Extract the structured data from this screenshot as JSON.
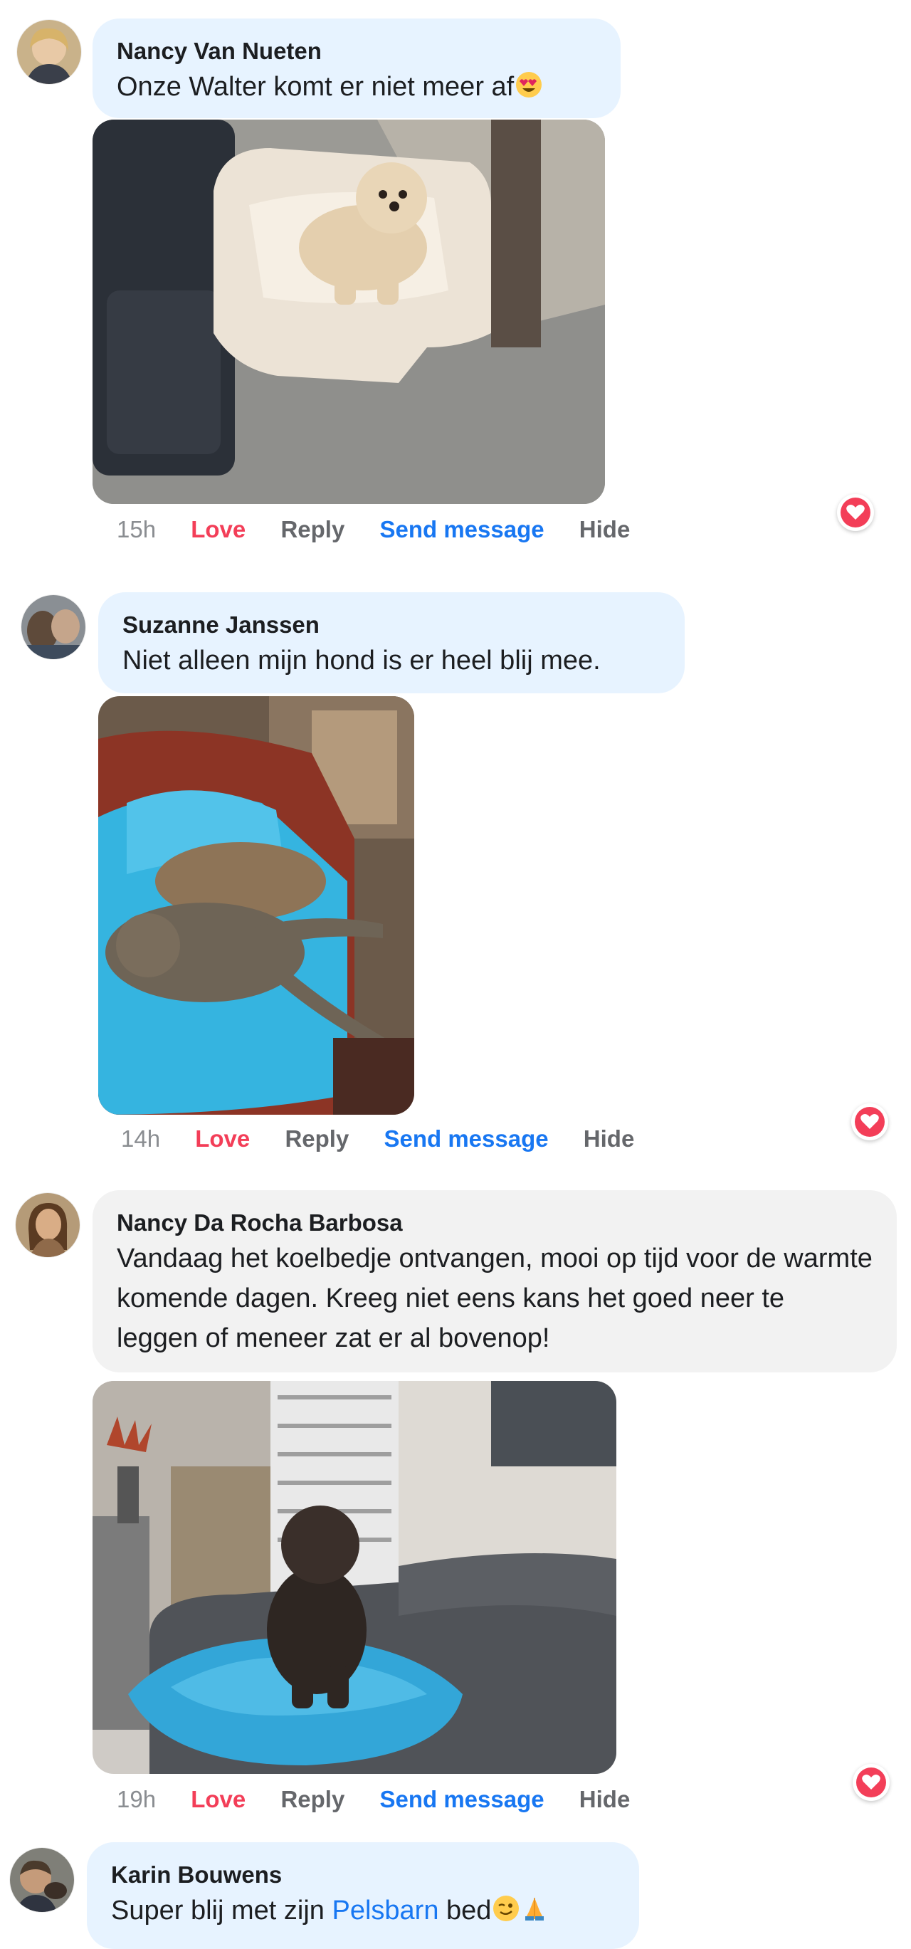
{
  "comments": [
    {
      "author": "Nancy Van Nueten",
      "text": "Onze Walter komt er niet meer af",
      "emoji": "heart-eyes-emoji",
      "time": "15h",
      "actions": {
        "love": "Love",
        "reply": "Reply",
        "send": "Send message",
        "hide": "Hide"
      }
    },
    {
      "author": "Suzanne Janssen",
      "text": "Niet alleen mijn hond is er heel blij mee.",
      "time": "14h",
      "actions": {
        "love": "Love",
        "reply": "Reply",
        "send": "Send message",
        "hide": "Hide"
      }
    },
    {
      "author": "Nancy Da Rocha Barbosa",
      "text": "Vandaag het koelbedje ontvangen, mooi op tijd voor de warmte komende dagen. Kreeg niet eens kans het goed neer te leggen of meneer zat er al bovenop!",
      "time": "19h",
      "actions": {
        "love": "Love",
        "reply": "Reply",
        "send": "Send message",
        "hide": "Hide"
      }
    },
    {
      "author": "Karin Bouwens",
      "text_before": "Super blij met zijn ",
      "link": "Pelsbarn",
      "text_after": " bed",
      "emojis": [
        "wink-emoji",
        "praying-hands-emoji"
      ]
    }
  ],
  "reaction_icon": "love-reaction-icon",
  "colors": {
    "love": "#f33e58",
    "link": "#1877f2",
    "bubble_blue": "#e7f3ff",
    "bubble_grey": "#f2f2f2",
    "muted": "#65676b"
  }
}
